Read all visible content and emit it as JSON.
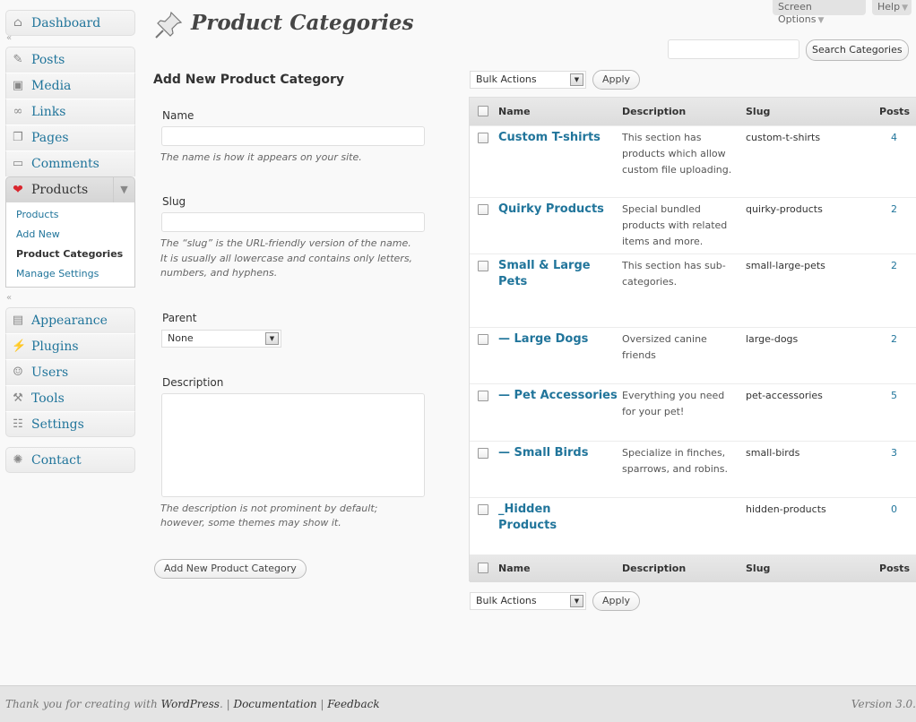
{
  "top_tabs": {
    "screen_options": "Screen Options",
    "help": "Help"
  },
  "menu": {
    "dashboard": "Dashboard",
    "posts": "Posts",
    "media": "Media",
    "links": "Links",
    "pages": "Pages",
    "comments": "Comments",
    "products": "Products",
    "products_sub": [
      "Products",
      "Add New",
      "Product Categories",
      "Manage Settings"
    ],
    "appearance": "Appearance",
    "plugins": "Plugins",
    "users": "Users",
    "tools": "Tools",
    "settings": "Settings",
    "contact": "Contact"
  },
  "page": {
    "title": "Product Categories"
  },
  "search": {
    "value": "",
    "button": "Search Categories"
  },
  "form": {
    "heading": "Add New Product Category",
    "name_label": "Name",
    "name_help": "The name is how it appears on your site.",
    "slug_label": "Slug",
    "slug_help_1": "The “slug” is the URL-friendly version of the name.",
    "slug_help_2": "It is usually all lowercase and contains only letters,",
    "slug_help_3": "numbers, and hyphens.",
    "parent_label": "Parent",
    "parent_value": "None",
    "desc_label": "Description",
    "desc_help_1": "The description is not prominent by default;",
    "desc_help_2": "however, some themes may show it.",
    "submit": "Add New Product Category"
  },
  "bulk": {
    "value": "Bulk Actions",
    "apply": "Apply"
  },
  "table": {
    "columns": {
      "name": "Name",
      "description": "Description",
      "slug": "Slug",
      "posts": "Posts"
    },
    "rows": [
      {
        "name": "Custom T-shirts",
        "description": "This section has products which allow custom file uploading.",
        "slug": "custom-t-shirts",
        "count": "4"
      },
      {
        "name": "Quirky Products",
        "description": "Special bundled products with related items and more.",
        "slug": "quirky-products",
        "count": "2"
      },
      {
        "name": "Small & Large Pets",
        "description": "This section has sub-categories.",
        "slug": "small-large-pets",
        "count": "2"
      },
      {
        "name": "— Large Dogs",
        "description": "Oversized canine friends",
        "slug": "large-dogs",
        "count": "2"
      },
      {
        "name": "— Pet Accessories",
        "description": "Everything you need for your pet!",
        "slug": "pet-accessories",
        "count": "5"
      },
      {
        "name": "— Small Birds",
        "description": "Specialize in finches, sparrows, and robins.",
        "slug": "small-birds",
        "count": "3"
      },
      {
        "name": "_Hidden Products",
        "description": "",
        "slug": "hidden-products",
        "count": "0"
      }
    ]
  },
  "footer": {
    "thanks": "Thank you for creating with",
    "wp": "WordPress",
    "documentation": "Documentation",
    "feedback": "Feedback",
    "version": "Version 3.0."
  }
}
